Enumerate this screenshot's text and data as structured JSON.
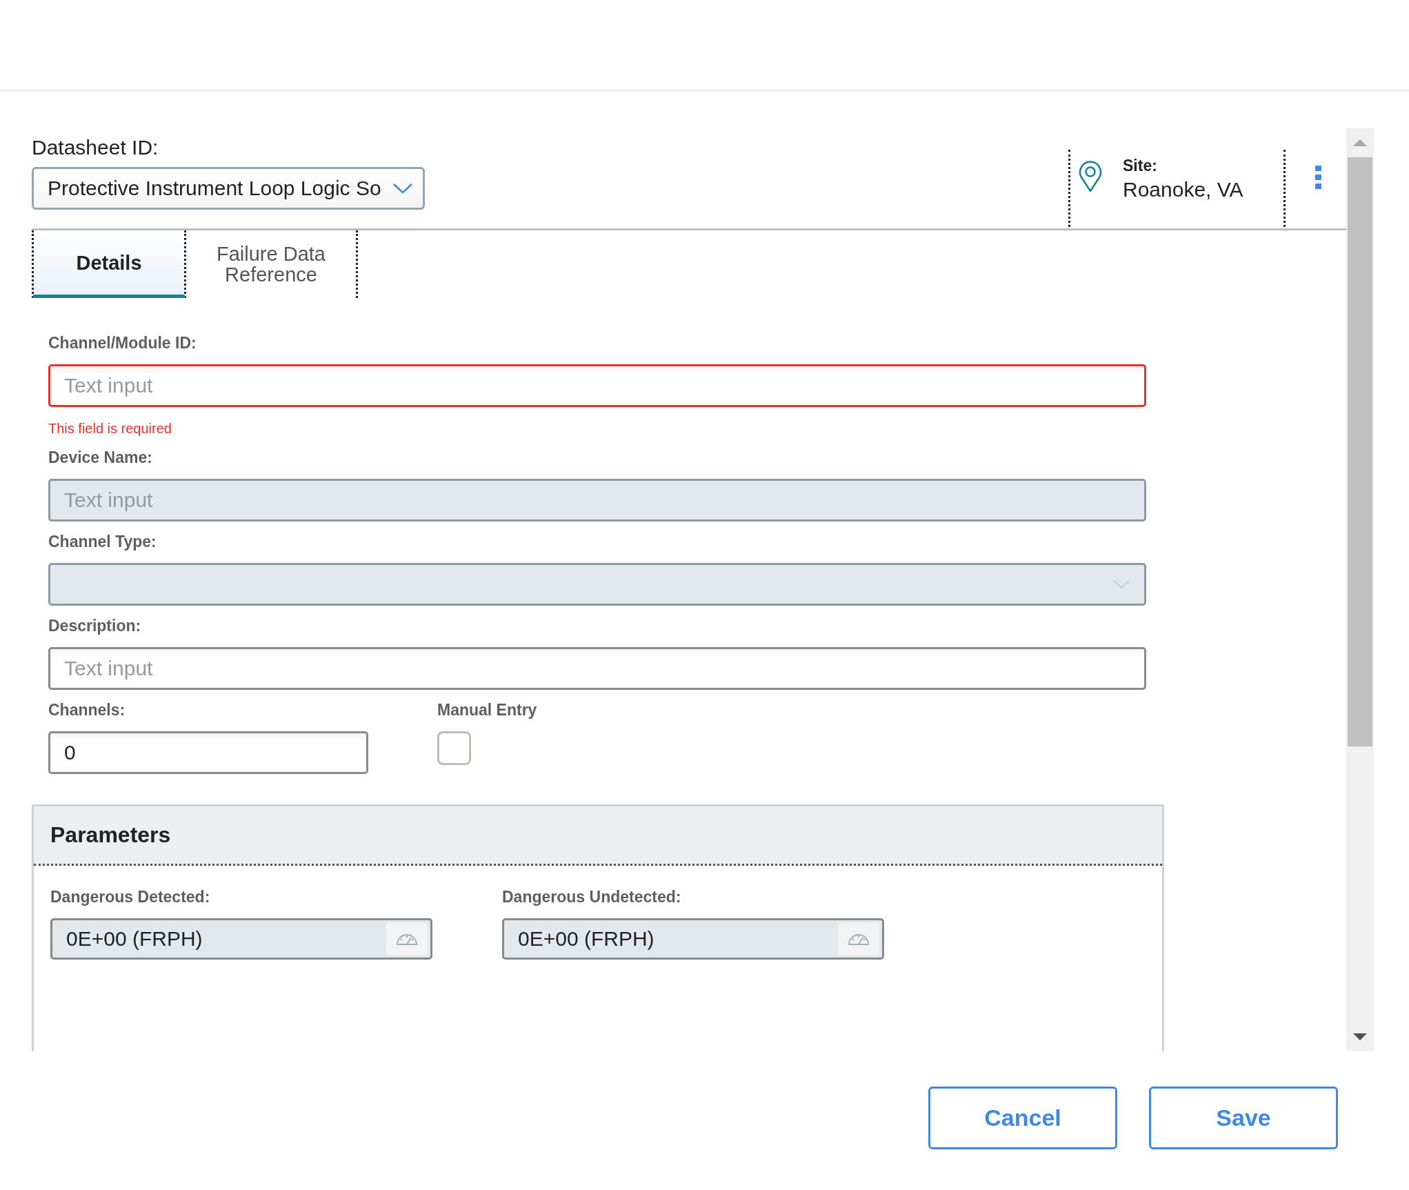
{
  "datasheet": {
    "label": "Datasheet ID:",
    "value": "Protective Instrument Loop Logic So"
  },
  "site": {
    "label": "Site:",
    "value": "Roanoke, VA"
  },
  "tabs": [
    {
      "label": "Details",
      "selected": true
    },
    {
      "label": "Failure Data Reference",
      "selected": false
    }
  ],
  "fields": [
    {
      "kind": "text",
      "label": "Channel/Module ID:",
      "placeholder": "Text input",
      "error": "This field is required",
      "disabled": false
    },
    {
      "kind": "text",
      "label": "Device Name:",
      "placeholder": "Text input",
      "disabled": true
    },
    {
      "kind": "select",
      "label": "Channel Type:",
      "disabled": true
    },
    {
      "kind": "text",
      "label": "Description:",
      "placeholder": "Text input",
      "disabled": false
    }
  ],
  "channels": {
    "label": "Channels:",
    "value": "0"
  },
  "manual_entry": {
    "label": "Manual Entry",
    "checked": false
  },
  "parameters": {
    "title": "Parameters",
    "fields": [
      {
        "label": "Dangerous Detected:",
        "value": "0E+00 (FRPH)"
      },
      {
        "label": "Dangerous Undetected:",
        "value": "0E+00 (FRPH)"
      }
    ]
  },
  "buttons": [
    {
      "label": "Cancel"
    },
    {
      "label": "Save"
    }
  ]
}
